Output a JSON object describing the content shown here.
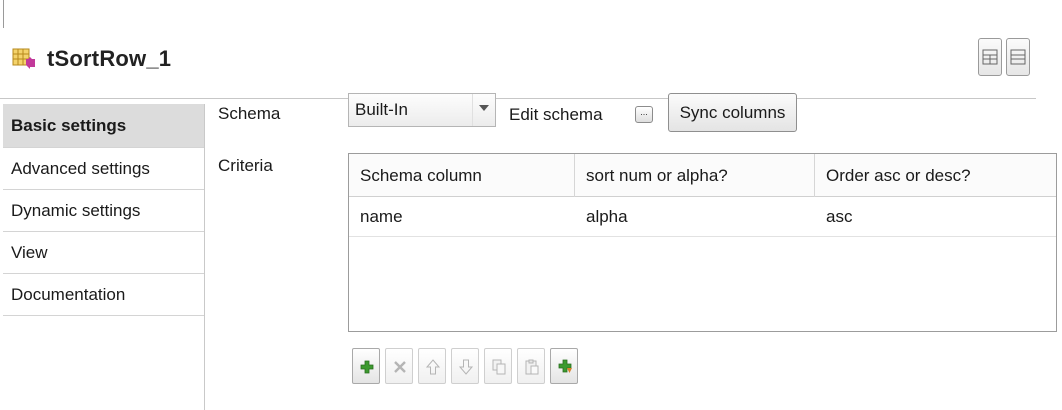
{
  "component": {
    "title": "tSortRow_1",
    "icon": "sort-row-component-icon"
  },
  "header_buttons": [
    {
      "icon": "grid-layout-icon"
    },
    {
      "icon": "row-layout-icon"
    }
  ],
  "sidebar": {
    "items": [
      {
        "label": "Basic settings",
        "active": true
      },
      {
        "label": "Advanced settings",
        "active": false
      },
      {
        "label": "Dynamic settings",
        "active": false
      },
      {
        "label": "View",
        "active": false
      },
      {
        "label": "Documentation",
        "active": false
      }
    ]
  },
  "form": {
    "schema_label": "Schema",
    "schema_value": "Built-In",
    "edit_schema_label": "Edit schema",
    "edit_schema_button": "...",
    "sync_columns_label": "Sync columns",
    "criteria_label": "Criteria"
  },
  "criteria_table": {
    "columns": [
      "Schema column",
      "sort num or alpha?",
      "Order asc or desc?"
    ],
    "rows": [
      [
        "name",
        "alpha",
        "asc"
      ]
    ]
  },
  "toolbar": {
    "buttons": [
      {
        "icon": "add-icon",
        "enabled": true
      },
      {
        "icon": "delete-icon",
        "enabled": false
      },
      {
        "icon": "move-up-icon",
        "enabled": false
      },
      {
        "icon": "move-down-icon",
        "enabled": false
      },
      {
        "icon": "copy-icon",
        "enabled": false
      },
      {
        "icon": "paste-icon",
        "enabled": false
      },
      {
        "icon": "duplicate-add-icon",
        "enabled": true
      }
    ]
  },
  "colors": {
    "active_tab_bg": "#dcdcdc",
    "add_green": "#3c9a2e",
    "paste_orange": "#d9822b"
  }
}
